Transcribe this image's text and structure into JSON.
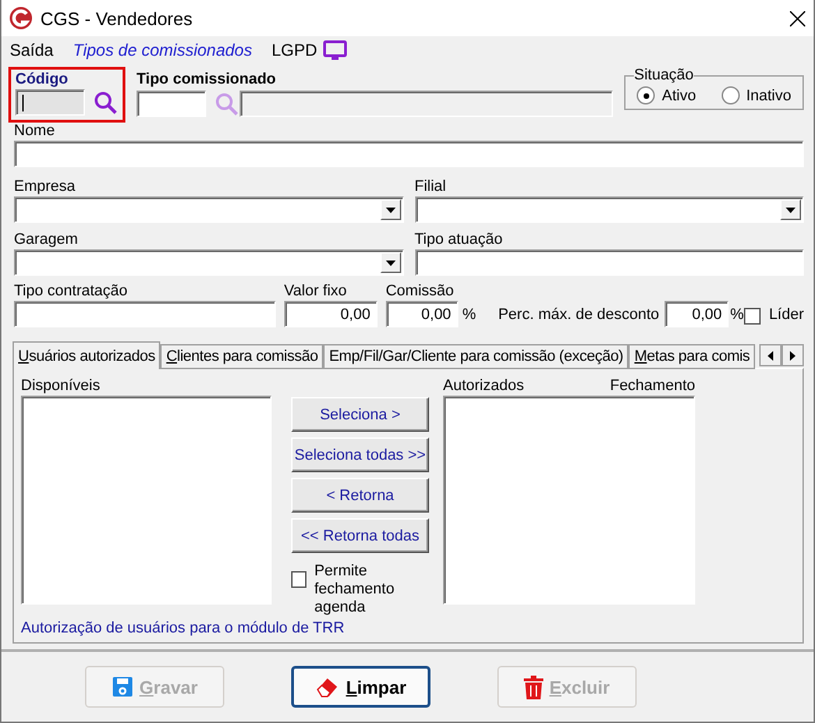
{
  "window": {
    "title": "CGS - Vendedores"
  },
  "menu": [
    {
      "label": "Saída",
      "kind": "plain"
    },
    {
      "label": "Tipos de comissionados",
      "kind": "link"
    },
    {
      "label": "LGPD",
      "kind": "icon"
    }
  ],
  "codigo": {
    "label": "Código",
    "highlighted": true
  },
  "tipo_comissionado": {
    "label": "Tipo comissionado"
  },
  "situacao": {
    "label": "Situação",
    "options": [
      {
        "label": "Ativo",
        "selected": true
      },
      {
        "label": "Inativo",
        "selected": false
      }
    ]
  },
  "nome": {
    "label": "Nome"
  },
  "row2": [
    {
      "label": "Empresa",
      "kind": "combo"
    },
    {
      "label": "Filial",
      "kind": "combo"
    }
  ],
  "row3": [
    {
      "label": "Garagem",
      "kind": "combo"
    },
    {
      "label": "Tipo atuação",
      "kind": "text"
    }
  ],
  "tipo_contratacao": {
    "label": "Tipo contratação"
  },
  "valor_fixo": {
    "label": "Valor fixo",
    "value": "0,00"
  },
  "comissao": {
    "label": "Comissão",
    "value": "0,00",
    "unit": "%"
  },
  "desconto": {
    "label": "Perc. máx. de desconto",
    "value": "0,00",
    "unit": "%"
  },
  "lider": {
    "label": "Líder",
    "checked": false
  },
  "tabs": [
    {
      "label": "Usuários autorizados",
      "selected": true,
      "mnemonic": true
    },
    {
      "label": "Clientes para comissão",
      "selected": false,
      "mnemonic": true
    },
    {
      "label": "Emp/Fil/Gar/Cliente para comissão (exceção)",
      "selected": false,
      "mnemonic": false
    },
    {
      "label": "Metas para comis",
      "selected": false,
      "mnemonic": true
    }
  ],
  "panel": {
    "available_label": "Disponíveis",
    "authorized_label": "Autorizados",
    "closing_label": "Fechamento",
    "buttons": [
      "Seleciona >",
      "Seleciona todas >>",
      "< Retorna",
      "<< Retorna todas"
    ],
    "permite": {
      "label": "Permite fechamento agenda",
      "checked": false
    },
    "note": "Autorização de usuários para o módulo de TRR"
  },
  "actions": [
    {
      "label": "Gravar",
      "kind": "save",
      "disabled": true,
      "focused": false
    },
    {
      "label": "Limpar",
      "kind": "clear",
      "disabled": false,
      "focused": true
    },
    {
      "label": "Excluir",
      "kind": "delete",
      "disabled": true,
      "focused": false
    }
  ]
}
